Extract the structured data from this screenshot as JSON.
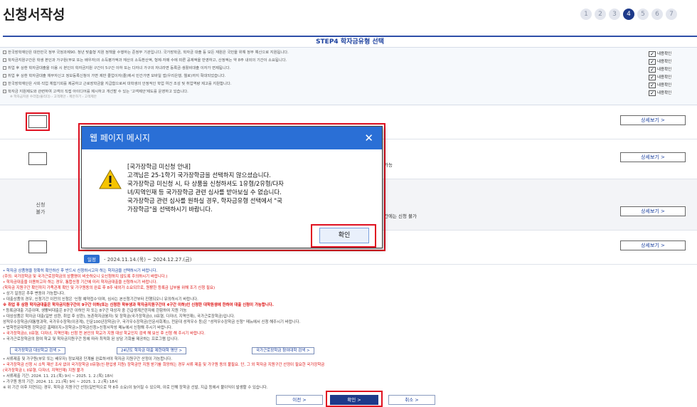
{
  "header": {
    "title": "신청서작성",
    "steps": [
      "1",
      "2",
      "3",
      "4",
      "5",
      "6",
      "7"
    ],
    "active_step": 4
  },
  "step_title": "STEP4 학자금유형 선택",
  "notice": {
    "lines": [
      "한국장학재단은 대한민국 정부 국정과제90. 청년 맞춤형 지원 정책을 수행하는 준정부 기관입니다. 국가장학금, 학자금 대출 등 모든 재원은 국민을 위해 정부 예산으로 지원됩니다.",
      "학자금지원구간은 학생 본인과 가구원(부모 또는 배우자)의 소득평가액과 재산의 소득환산액, 형제·자매 수에 따른 공제액을 반영하고, 산정액는 약 8주 내외의 기간이 소요됩니다.",
      "취업 후 상환 학자금대출을 이용 시 본인의 학자금지원 구간이 5구간 이하 또는 다자녀 가구의 자녀라면 등록금·생활비대출 이자가 면제됩니다.",
      "취업 후 상환 학자금대출 채무자신고 정보등록신청이 가변 제반 졸업이자(졸)에서 민간가면 모바일 앱(우리은행, 웰로)까지 확대되었습니다.",
      "한국장학재단은 사회·직업 체험기회를 제공하고 근로장학금을 지급함으로써 대학생의 안정적인 학업 여건 조성 및 취업역량 제고를 지원합니다.",
      "학자금 지원제도와 관련하여 고객의 직접 아이디어를 제시하고 개선할 수 있는 '고객제안'제도를 운영하고 있습니다."
    ],
    "sub_note": "※ 학자금지원 수리업(플리더) › 고객제안 › 제안하기 › 고객제안",
    "confirm_label": "내용확인"
  },
  "rows": [
    {
      "detail_label": "상세보기 >"
    },
    {
      "detail_label": "상세보기 >",
      "tail": "가능"
    },
    {
      "status_line1": "신청",
      "status_line2": "불가",
      "detail_label": "상세보기 >",
      "tail": "간에는 신청 불가"
    },
    {
      "detail_label": "상세보기 >",
      "period_label": "일정",
      "period": "- 2024.11.14.(목) ~ 2024.12.27.(금)"
    }
  ],
  "dialog": {
    "title": "웹 페이지 메시지",
    "close": "✕",
    "heading": "[국가장학금 미신청 안내]",
    "lines": [
      "고객님은 25-1학기 국가장학금을 선택하지 않으셨습니다.",
      "국가장학금 미신청 시, 타 상품을 신청하셔도 1유형/2유형/다자",
      "녀/지역인재 등 국가장학금 관련 심사를 받아보실 수 없습니다.",
      "국가장학금 관련 심사를 원하실 경우, 학자금유형 선택에서 \"국",
      "가장학금\"을 선택하시기 바랍니다."
    ],
    "ok": "확인"
  },
  "bottom": {
    "lines": [
      {
        "text": "• 학자금 상품명을 정확히 확인하신 후 반드시 신청하시고자 하는 학자금을 선택하시기 바랍니다.",
        "style": "blue"
      },
      {
        "text": "(주의: 국가장학금 및 국가근로장학금의 상품명이 비슷하오니 오신청하지 않도록 주의하시기 바랍니다.)",
        "style": "red"
      },
      {
        "text": "• 학자금대출을 이용하고자 하는 경우, 통합신청 기간에 미리 학자금대출을 신청하시기 바랍니다.",
        "style": "red"
      },
      {
        "text": "(학자금 지원구간 확인까지 가족관계 확인 및 가구원동의 완료 후 8주 내외가 소요되므로, 원활한 등록금 납부를 위해 조기 신청 필요)",
        "style": "red"
      },
      {
        "text": "• 상기 일정은 추후 변동이 가능합니다.",
        "style": ""
      },
      {
        "text": "• 대출상품의 경우, 신청기간 이전의 신청은 '신청 예약접수'이며, 심사는 본신청기간부터 진행되오니 유의하시기 바랍니다.",
        "style": ""
      },
      {
        "text": "※ 취업 후 상환 학자금대출은 학자금지원구간이 9구간 이하(또는 신청한 학부생과 학자금지원구간이 4구간 이하)인 신청한 대학원생에 한하여 대출 신청이 가능합니다.",
        "style": "red bold"
      },
      {
        "text": "* 등록금대출 기준이며, 생활비대출은 8구간 이하인 자 또는 8구간 대상자 중 긴급생계곤란자에 한함하여 지원 가능",
        "style": ""
      },
      {
        "text": "• 대상상품은 학자금 대출(일반 상환, 취업 후 상환), 농촌학자금융자) 및 장학금(국가장학금(I, II유형, 다자녀, 지역인재), 국가근로장학금)입니다.",
        "style": ""
      },
      {
        "text": "성적우수장학금(대통령과학, 국가우수장학(이공계), 인문100년장학금(구, 국가우수장학금(인문사회계)), 전문대 성적우수 등)은 \"성적우수장학금 신청\" 메뉴에서 신청 해주시기 바랍니다.",
        "style": ""
      },
      {
        "text": "• 법학전문대학원 장학금은 홈페이지>장학금>장학금신청>신청서작성 메뉴에서 신청해 주시기 바랍니다.",
        "style": ""
      },
      {
        "text": "• 국가장학금(I, II유형, 다자녀, 지역인재) 신청 전 본인의 학교가 지원 대상 학교인지 검색 해 보신 후 신청 해 주시기 바랍니다.",
        "style": "red"
      },
      {
        "text": "• 국가근로장학금의 참여 학교 및 학자금지원구간 등에 따라 최적화 된 상담 기회를 제공하는 프로그램 입니다.",
        "style": ""
      }
    ],
    "link_buttons": [
      "국가장학금 대상학교 검색 >",
      "24년도 학자금 대출 제한대학 명단 >",
      "국가근로장학금 참여대학 검색 >"
    ],
    "lines2": [
      {
        "text": "• 서류제출 및 가구원(부모 또는 배우자) 정보제공 단계를 완료하셔야 학자금 지원구간 산정이 가능합니다.",
        "style": ""
      },
      {
        "text": "• 국가장학금 신청 시 소득 재산 조사 없이 국가장학금 II유형(신·편입생 지원) 장학금만 지원 받기를 희망하는 경우 서류 제출 및 가구원 동의 불필요. 단, 그 외 학자금 지원구간 산정이 필요한 국가장학금",
        "style": "red"
      },
      {
        "text": "(국가장학금 I, II유형, 다자녀, 지역인재) 지원 불가",
        "style": "red"
      },
      {
        "text": "• 서류제출 기간: 2024. 11. 21.(목) 9시 ~ 2025. 1. 2.(목) 18시",
        "style": ""
      },
      {
        "text": "• 가구원 동의 기간: 2024. 11. 21.(목) 9시 ~ 2025. 1. 2.(목) 18시",
        "style": ""
      },
      {
        "text": "※ 위 기간 이후 지연되는 경우, 학자금 지원구간 산정(일반적으로 약 8주 소요)이 늦어질 수 있으며, 이로 인해 장학금 선발, 지급 등에서 불이익이 발생할 수 있습니다.",
        "style": ""
      }
    ],
    "buttons": {
      "prev": "이전 >",
      "next": "확인 >",
      "cancel": "취소 >"
    }
  },
  "colors": {
    "accent": "#1e3a8a",
    "dialog_title": "#2a6fd6",
    "highlight": "#e01020",
    "notice_red": "#d11111"
  }
}
